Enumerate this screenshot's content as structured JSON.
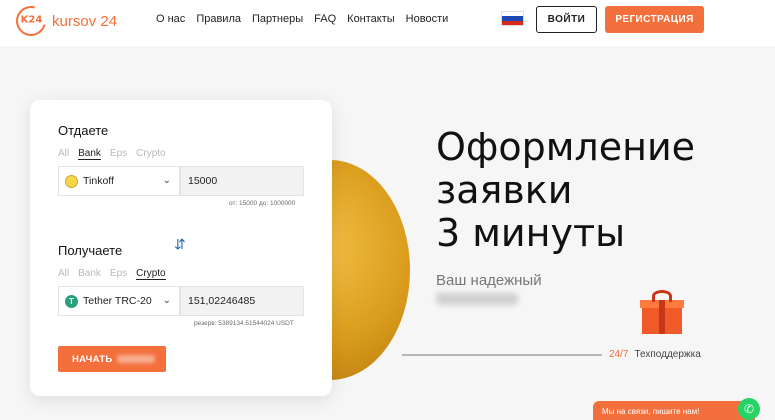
{
  "header": {
    "logo_mark": "K24",
    "logo_text": "kursov 24",
    "nav": [
      "О нас",
      "Правила",
      "Партнеры",
      "FAQ",
      "Контакты",
      "Новости"
    ],
    "login_label": "ВОЙТИ",
    "register_label": "РЕГИСТРАЦИЯ"
  },
  "give": {
    "title": "Отдаете",
    "tabs": [
      "All",
      "Bank",
      "Eps",
      "Crypto"
    ],
    "active_tab": "Bank",
    "currency": "Tinkoff",
    "currency_icon": "tinkoff-coin-icon",
    "amount": "15000",
    "limits": "от: 15000 до: 1000000"
  },
  "receive": {
    "title": "Получаете",
    "tabs": [
      "All",
      "Bank",
      "Eps",
      "Crypto"
    ],
    "active_tab": "Crypto",
    "currency": "Tether TRC-20",
    "currency_icon": "tether-coin-icon",
    "amount": "151,02246485",
    "reserve": "резерв: 5389134.51544024 USDT"
  },
  "start_button": "НАЧАТЬ",
  "hero": {
    "lines": [
      "Оформление",
      "заявки",
      "3 минуты"
    ],
    "tagline": "Ваш надежный"
  },
  "support": {
    "hours": "24/7",
    "label": "Техподдержка"
  },
  "chat": {
    "label": "Мы на связи, пишите нам!"
  },
  "colors": {
    "accent": "#f36f3b",
    "swap": "#2a6fb5",
    "whatsapp": "#25d366"
  }
}
